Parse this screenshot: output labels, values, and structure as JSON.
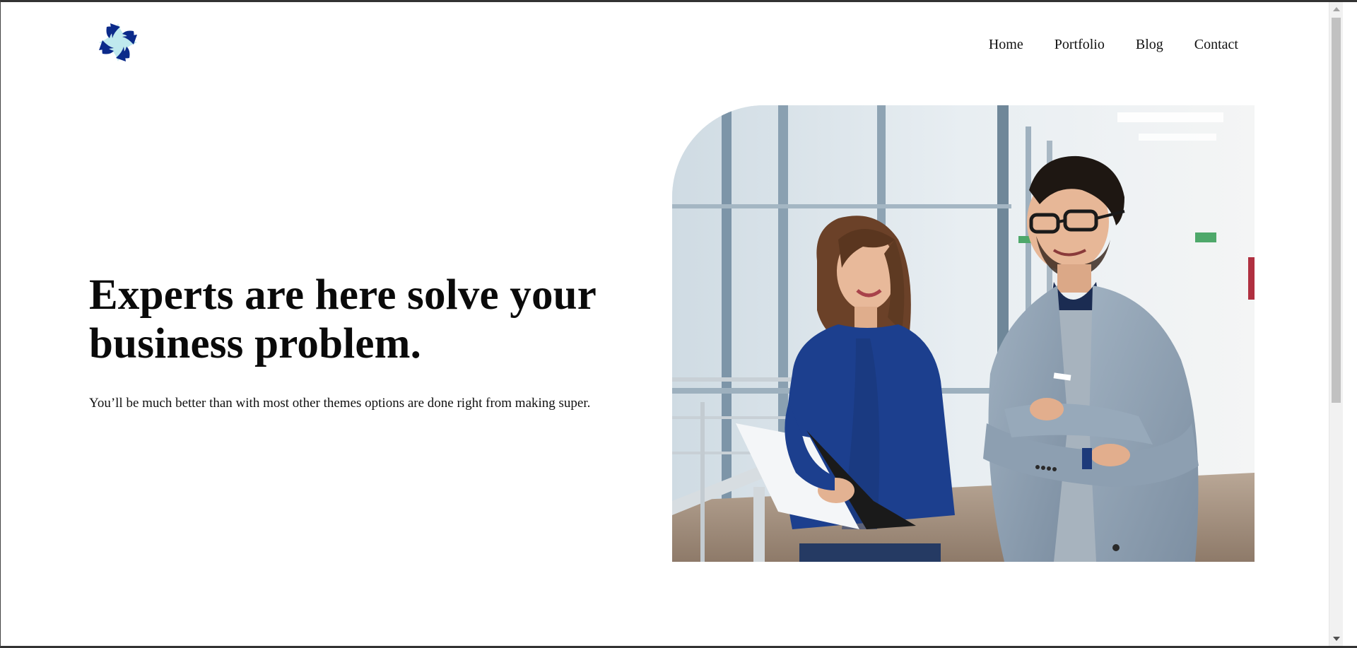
{
  "header": {
    "logo_icon": "four-point-star-logo-icon",
    "brand_colors": {
      "primary": "#0b2a8a",
      "accent": "#bfe9ee"
    },
    "nav": [
      {
        "label": "Home"
      },
      {
        "label": "Portfolio"
      },
      {
        "label": "Blog"
      },
      {
        "label": "Contact"
      }
    ]
  },
  "hero": {
    "title": "Experts are here solve your business problem.",
    "subtitle": "You’ll be much better than with most other themes options are done right from making super."
  }
}
